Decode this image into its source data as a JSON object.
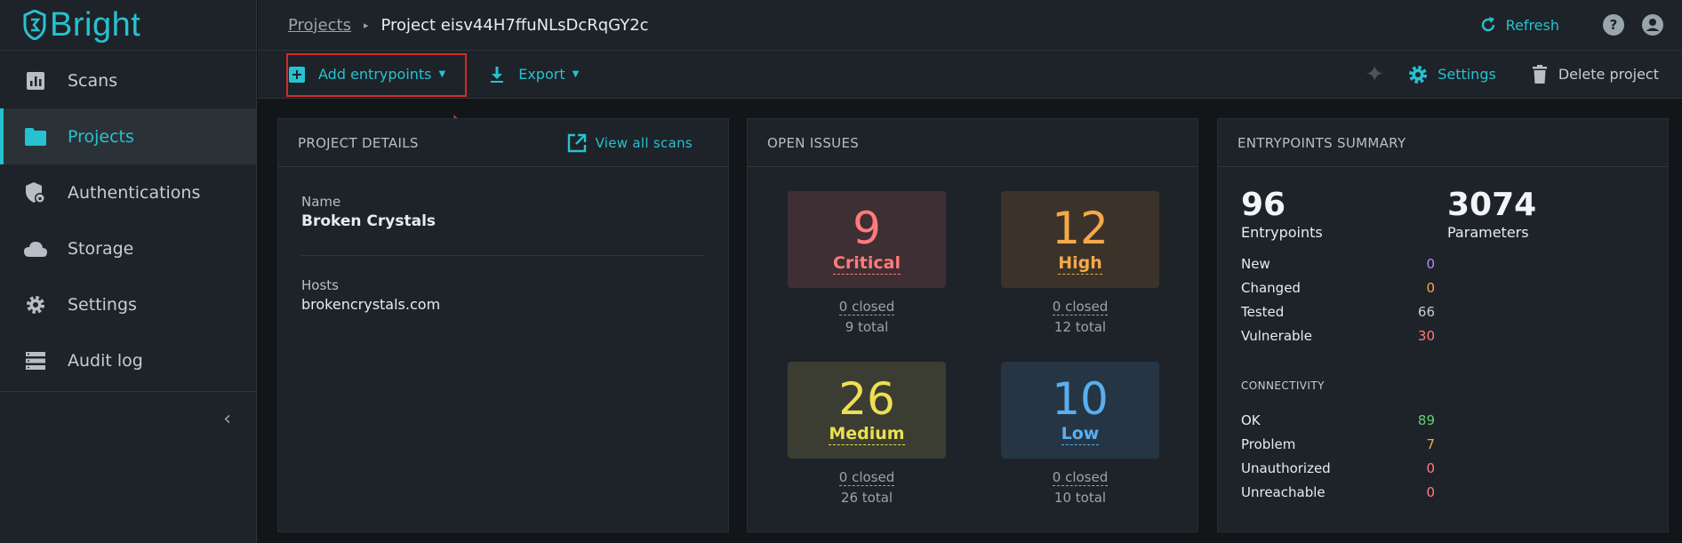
{
  "app": {
    "logo_text": "Bright"
  },
  "sidebar": {
    "items": [
      {
        "label": "Scans",
        "icon": "bar-chart-icon"
      },
      {
        "label": "Projects",
        "icon": "folder-icon",
        "active": true
      },
      {
        "label": "Authentications",
        "icon": "shield-lock-icon"
      },
      {
        "label": "Storage",
        "icon": "cloud-icon"
      },
      {
        "label": "Settings",
        "icon": "gear-icon"
      },
      {
        "label": "Audit log",
        "icon": "list-icon"
      }
    ],
    "collapse_glyph": "‹"
  },
  "breadcrumb": {
    "parent": "Projects",
    "separator": "▸",
    "current": "Project eisv44H7ffuNLsDcRqGY2c"
  },
  "topbar": {
    "refresh_label": "Refresh"
  },
  "toolbar": {
    "add_entrypoints_label": "Add entrypoints",
    "export_label": "Export",
    "settings_label": "Settings",
    "delete_label": "Delete project"
  },
  "project_details": {
    "title": "PROJECT DETAILS",
    "view_all_label": "View all scans",
    "name_label": "Name",
    "name_value": "Broken Crystals",
    "hosts_label": "Hosts",
    "hosts_value": "brokencrystals.com"
  },
  "open_issues": {
    "title": "OPEN ISSUES",
    "tiles": [
      {
        "count": "9",
        "label": "Critical",
        "closed": "0 closed",
        "total": "9 total",
        "color": "#ff7b7b",
        "bg": "#3d2f33"
      },
      {
        "count": "12",
        "label": "High",
        "closed": "0 closed",
        "total": "12 total",
        "color": "#f5a94a",
        "bg": "#3b3329"
      },
      {
        "count": "26",
        "label": "Medium",
        "closed": "0 closed",
        "total": "26 total",
        "color": "#ecdf52",
        "bg": "#3b3d33"
      },
      {
        "count": "10",
        "label": "Low",
        "closed": "0 closed",
        "total": "10 total",
        "color": "#5aaef0",
        "bg": "#263544"
      }
    ]
  },
  "entrypoints_summary": {
    "title": "ENTRYPOINTS SUMMARY",
    "entrypoints_count": "96",
    "entrypoints_label": "Entrypoints",
    "parameters_count": "3074",
    "parameters_label": "Parameters",
    "rows": [
      {
        "label": "New",
        "value": "0",
        "color": "#b98cf0"
      },
      {
        "label": "Changed",
        "value": "0",
        "color": "#f5a94a"
      },
      {
        "label": "Tested",
        "value": "66",
        "color": "#c6cdd2"
      },
      {
        "label": "Vulnerable",
        "value": "30",
        "color": "#ff7b7b"
      }
    ],
    "connectivity_title": "CONNECTIVITY",
    "connectivity": [
      {
        "label": "OK",
        "value": "89",
        "color": "#5fd07a"
      },
      {
        "label": "Problem",
        "value": "7",
        "color": "#f5a94a"
      },
      {
        "label": "Unauthorized",
        "value": "0",
        "color": "#ff7b7b"
      },
      {
        "label": "Unreachable",
        "value": "0",
        "color": "#ff7b7b"
      }
    ]
  },
  "colors": {
    "accent": "#28c1cf",
    "highlight_border": "#d42b2b"
  }
}
